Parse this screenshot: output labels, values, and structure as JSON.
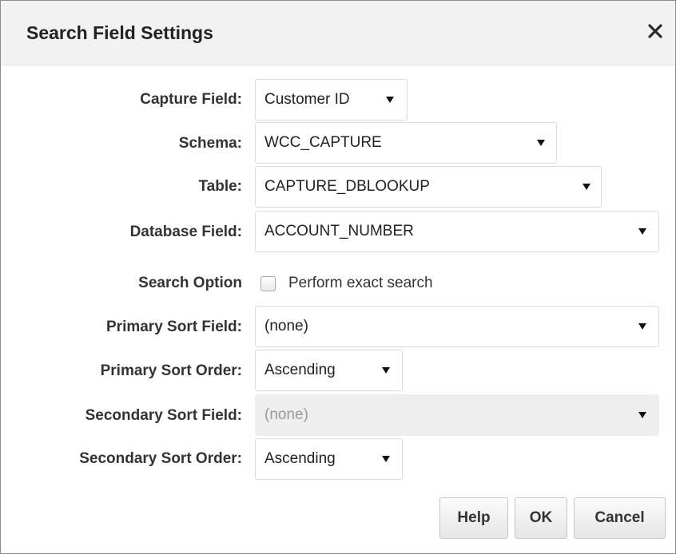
{
  "dialog": {
    "title": "Search Field Settings",
    "close_icon": "close-icon"
  },
  "form": {
    "capture_field": {
      "label": "Capture Field:",
      "value": "Customer ID"
    },
    "schema": {
      "label": "Schema:",
      "value": "WCC_CAPTURE"
    },
    "table": {
      "label": "Table:",
      "value": "CAPTURE_DBLOOKUP"
    },
    "database_field": {
      "label": "Database Field:",
      "value": "ACCOUNT_NUMBER"
    },
    "search_option": {
      "label": "Search Option",
      "checkbox_label": "Perform exact search",
      "checked": false
    },
    "primary_sort_field": {
      "label": "Primary Sort Field:",
      "value": "(none)"
    },
    "primary_sort_order": {
      "label": "Primary Sort Order:",
      "value": "Ascending"
    },
    "secondary_sort_field": {
      "label": "Secondary Sort Field:",
      "value": "(none)",
      "disabled": true
    },
    "secondary_sort_order": {
      "label": "Secondary Sort Order:",
      "value": "Ascending"
    }
  },
  "buttons": {
    "help": "Help",
    "ok": "OK",
    "cancel": "Cancel"
  },
  "icons": {
    "dropdown": "triangle-down-icon",
    "close": "close-icon"
  },
  "colors": {
    "titlebar_bg": "#f2f2f2",
    "text": "#333333",
    "disabled_bg": "#eeeeee",
    "disabled_text": "#9a9a9a"
  }
}
